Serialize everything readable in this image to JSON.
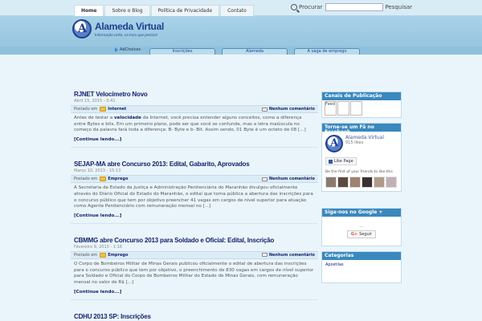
{
  "nav": {
    "items": [
      "Home",
      "Sobre o Blog",
      "Política de Privacidade",
      "Contato"
    ],
    "active": 0
  },
  "search": {
    "label": "Procurar",
    "value": "",
    "button": "Pesquisar"
  },
  "site": {
    "title": "Alameda Virtual",
    "tagline": "Informação certa, na hora que precisa!",
    "logo_letter": "A"
  },
  "adbar": {
    "adchoices": "AdChoices",
    "links": [
      "Inscrições",
      "Alameda",
      "A vaga de emprego"
    ]
  },
  "posts": [
    {
      "title": "RJNET Velocímetro Novo",
      "date": "Abril 15, 2015 - 0:41",
      "posted_in": "Postado em",
      "category": "Internet",
      "comments": "Nenhum comentário",
      "body_pre": "Antes de testar a ",
      "body_bold": "velocidade",
      "body_post": " da Internet, você precisa entender alguns conceitos, como a diferença entre Bytes e bits. Em um primeiro plano, pode ser que você se confunda, mas a letra maiúscula no começo da palavra fará toda a diferença: B- Byte e b- Bit. Assim sendo, 01 Byte é um octeto de 08 [...]",
      "read_more": "[Continue lendo...]"
    },
    {
      "title": "SEJAP-MA abre Concurso 2013: Edital, Gabarito, Aprovados",
      "date": "Março 10, 2013 - 15:13",
      "posted_in": "Postado em",
      "category": "Emprego",
      "comments": "Nenhum comentário",
      "body_pre": "A Secretaria de Estado da Justiça e Administração Penitenciária do Maranhão divulgou oficialmente através do Diário Oficial do Estado do Maranhão, o edital que torna pública a abertura das inscrições para o concurso público que tem por objetivo preencher 41 vagas em cargos de nível superior para atuação como Agente Penitenciário com remuneração mensal no [...]",
      "body_bold": "",
      "body_post": "",
      "read_more": "[Continue lendo...]"
    },
    {
      "title": "CBMMG abre Concurso 2013 para Soldado e Oficial: Edital, Inscrição",
      "date": "Fevereiro 9, 2013 - 1:16",
      "posted_in": "Postado em",
      "category": "Emprego",
      "comments": "Nenhum comentário",
      "body_pre": "O Corpo de Bombeiros Militar de Minas Gerais publicou oficialmente o edital de abertura das inscrições para o concurso público que tem por objetivo, o preenchimento de 830 vagas em cargos de nível superior para Soldado e Oficial do Corpo de Bombeiros Militar do Estado de Minas Gerais, com remuneração mensal no valor de R$ [...]",
      "body_bold": "",
      "body_post": "",
      "read_more": "[Continue lendo...]"
    },
    {
      "title": "CDHU 2013 SP: Inscrições",
      "date": "",
      "posted_in": "",
      "category": "",
      "comments": "",
      "body_pre": "",
      "body_bold": "",
      "body_post": "",
      "read_more": ""
    }
  ],
  "sidebar": {
    "feed_title": "Canais de Publicação",
    "feed_label": "Feed",
    "fb_title": "Torne-se um Fã no Facebook",
    "fb_name": "Alameda Virtual",
    "fb_likes": "915 likes",
    "fb_like_btn": "Like Page",
    "fb_friends": "Be the first of your friends to like this",
    "google_title": "Siga-nos no Google +",
    "google_dots": "...",
    "google_btn": "Seguir",
    "google_icon": "G+",
    "categories_title": "Categorias",
    "categories": [
      "Apostilas"
    ]
  },
  "colors": {
    "accent": "#3a88be",
    "title_blue": "#14236e",
    "header": "#a9d2e8"
  }
}
